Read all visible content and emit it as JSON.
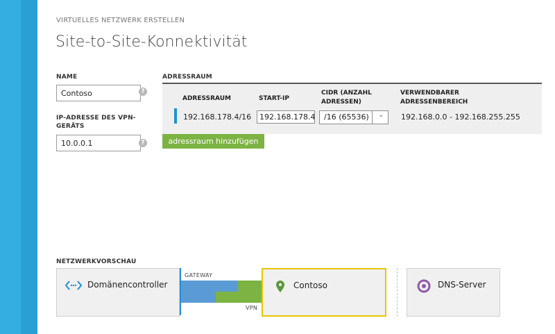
{
  "header": {
    "eyebrow": "VIRTUELLES NETZWERK ERSTELLEN",
    "title": "Site-to-Site-Konnektivität"
  },
  "form": {
    "name_label": "NAME",
    "name_value": "Contoso",
    "vpn_label_line1": "IP-ADRESSE DES VPN-",
    "vpn_label_line2": "GERÄTS",
    "vpn_value": "10.0.0.1",
    "help_glyph": "?"
  },
  "address_space": {
    "section_label": "ADRESSRAUM",
    "columns": {
      "adressraum": "ADRESSRAUM",
      "start_ip": "START-IP",
      "cidr_line1": "CIDR (ANZAHL",
      "cidr_line2": "ADRESSEN)",
      "usable_line1": "VERWENDBARER",
      "usable_line2": "ADRESSENBEREICH"
    },
    "rows": [
      {
        "adressraum": "192.168.178.4/16",
        "start_ip": "192.168.178.4",
        "cidr": "/16 (65536)",
        "usable_range": "192.168.0.0 - 192.168.255.255"
      }
    ],
    "add_button": "adressraum hinzufügen"
  },
  "preview": {
    "label": "NETZWERKVORSCHAU",
    "domain_controller": "Domänencontroller",
    "gateway_label": "GATEWAY",
    "vpn_label": "VPN",
    "site_name": "Contoso",
    "dns_server": "DNS-Server"
  },
  "colors": {
    "rail_blue": "#34aee0",
    "accent_blue": "#1e90d8",
    "gateway_blue": "#5b9bd5",
    "vpn_green": "#7cb342",
    "selected_yellow": "#e8c400",
    "dns_purple": "#8e5aa8",
    "pin_green": "#5a9a3a"
  },
  "icons": {
    "domain_controller": "code-brackets-icon",
    "site": "map-pin-icon",
    "dns": "target-circle-icon",
    "dropdown": "chevron-down-icon",
    "help": "question-circle-icon"
  }
}
